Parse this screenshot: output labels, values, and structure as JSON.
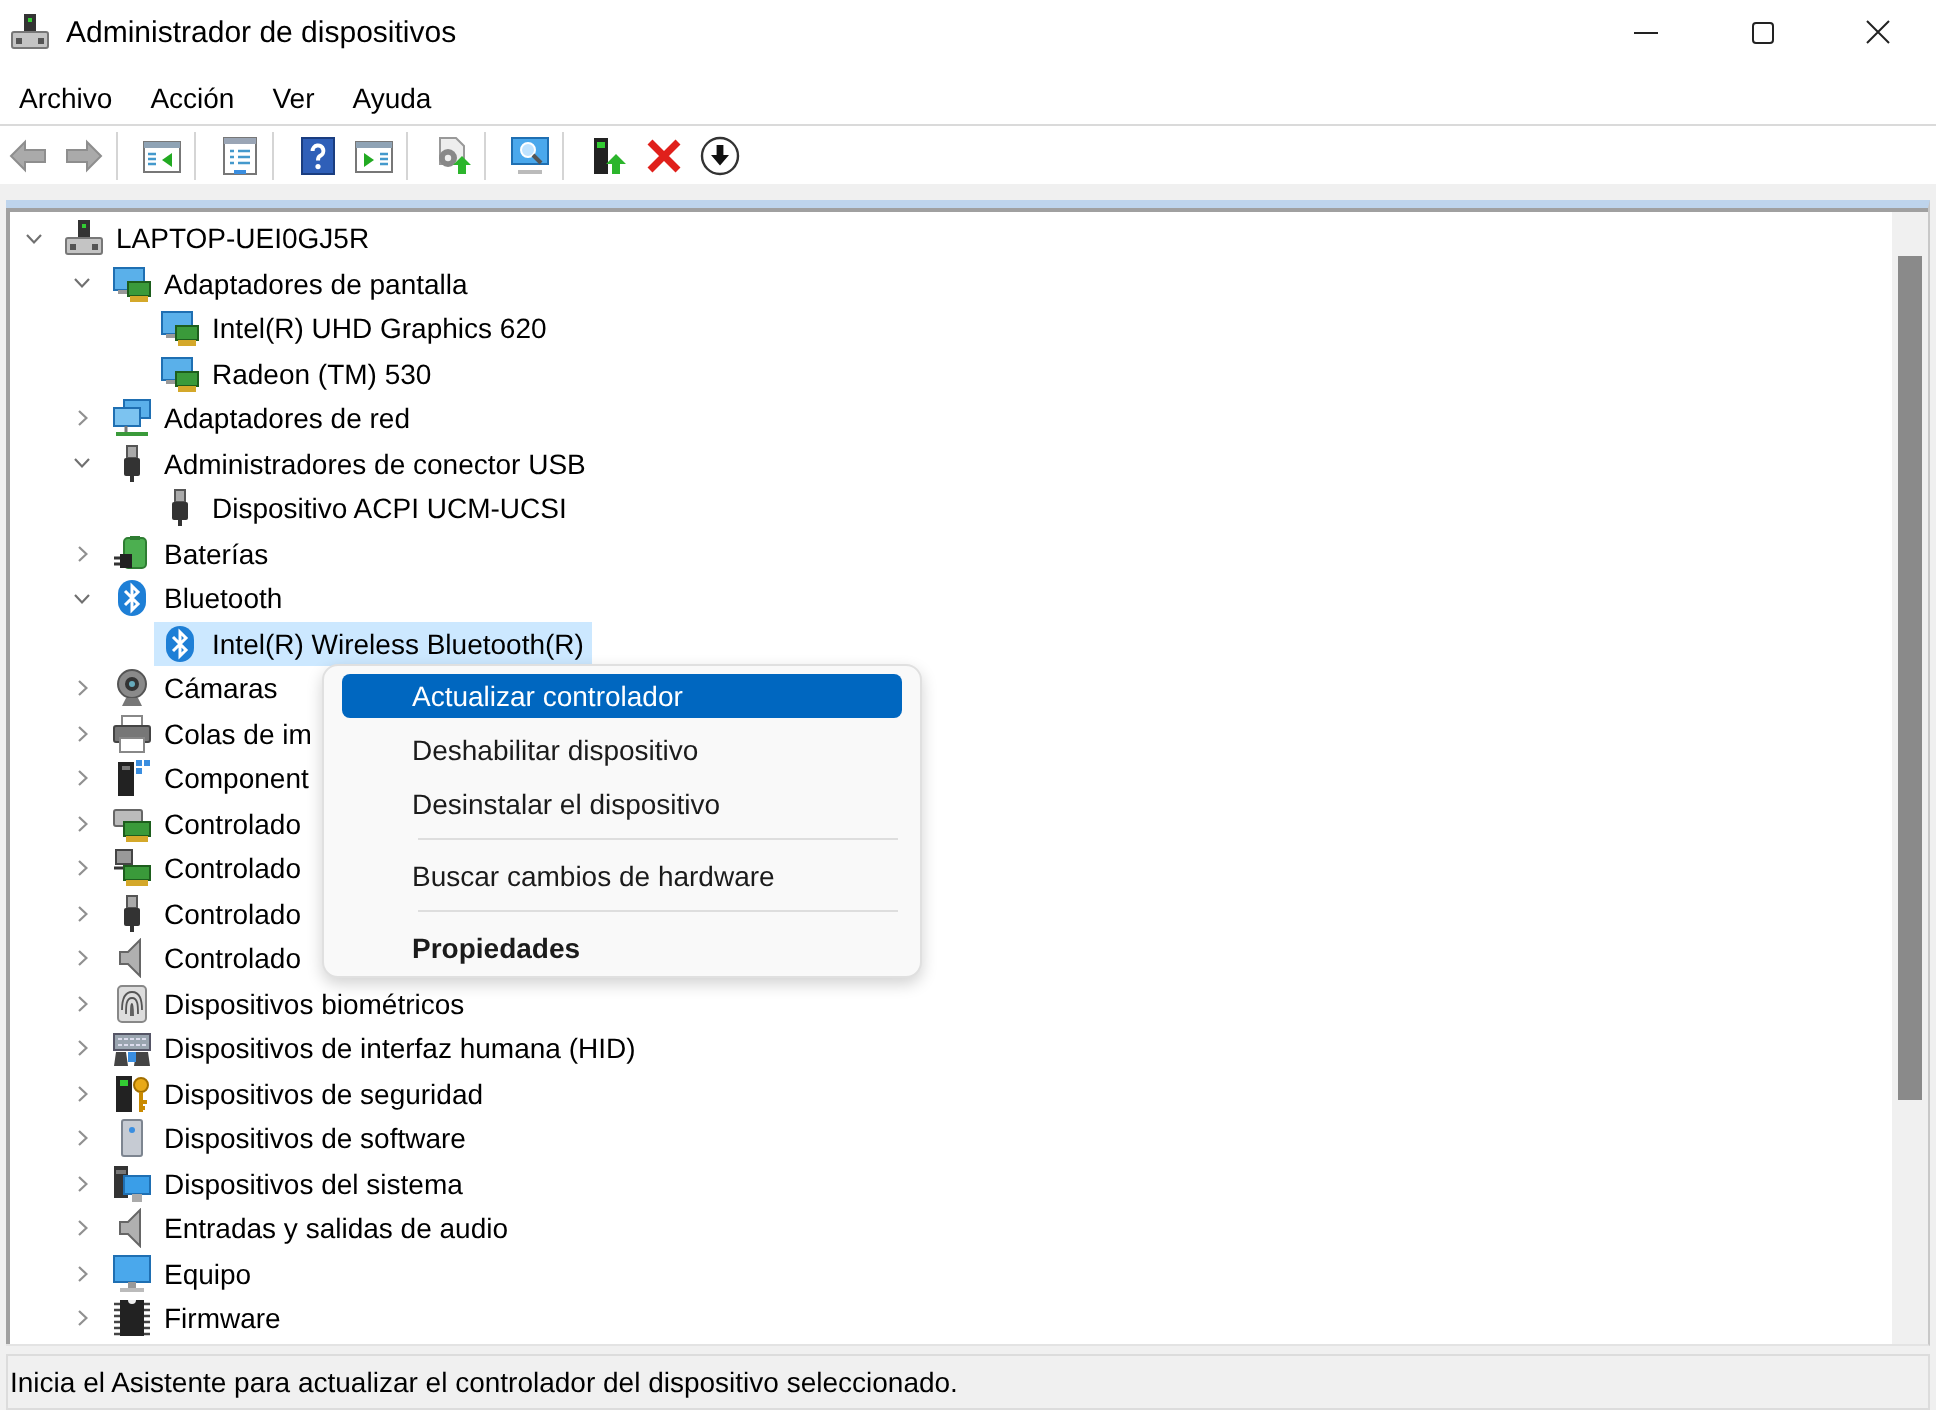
{
  "window": {
    "title": "Administrador de dispositivos"
  },
  "menu_bar": [
    "Archivo",
    "Acción",
    "Ver",
    "Ayuda"
  ],
  "toolbar": {
    "groups": [
      [
        {
          "kind": "back",
          "disabled": true
        },
        {
          "kind": "forward",
          "disabled": true
        }
      ],
      [
        {
          "kind": "console-tree",
          "disabled": false
        }
      ],
      [
        {
          "kind": "properties",
          "disabled": false
        }
      ],
      [
        {
          "kind": "help",
          "disabled": false
        },
        {
          "kind": "action-pane",
          "disabled": false
        }
      ],
      [
        {
          "kind": "scan",
          "disabled": false
        }
      ],
      [
        {
          "kind": "monitor-search",
          "disabled": false
        }
      ],
      [
        {
          "kind": "update",
          "disabled": false
        },
        {
          "kind": "uninstall",
          "disabled": false
        },
        {
          "kind": "disable",
          "disabled": false
        }
      ]
    ]
  },
  "tree": [
    {
      "label": "LAPTOP-UEI0GJ5R",
      "kind": "computer",
      "expanded": true,
      "selected": false,
      "children": [
        {
          "label": "Adaptadores de pantalla",
          "kind": "display",
          "expanded": true,
          "selected": false,
          "children": [
            {
              "label": "Intel(R) UHD Graphics 620",
              "kind": "display",
              "selected": false
            },
            {
              "label": "Radeon (TM) 530",
              "kind": "display",
              "selected": false
            }
          ]
        },
        {
          "label": "Adaptadores de red",
          "kind": "network",
          "expanded": false,
          "selected": false
        },
        {
          "label": "Administradores de conector USB",
          "kind": "usb",
          "expanded": true,
          "selected": false,
          "children": [
            {
              "label": "Dispositivo ACPI UCM-UCSI",
              "kind": "usb",
              "selected": false
            }
          ]
        },
        {
          "label": "Baterías",
          "kind": "battery",
          "expanded": false,
          "selected": false
        },
        {
          "label": "Bluetooth",
          "kind": "bluetooth",
          "expanded": true,
          "selected": false,
          "children": [
            {
              "label": "Intel(R) Wireless Bluetooth(R)",
              "kind": "bluetooth",
              "selected": true
            }
          ]
        },
        {
          "label": "Cámaras",
          "kind": "camera",
          "expanded": false,
          "selected": false
        },
        {
          "label": "Colas de im",
          "kind": "printer",
          "expanded": false,
          "selected": false
        },
        {
          "label": "Component",
          "kind": "component",
          "expanded": false,
          "selected": false
        },
        {
          "label": "Controlado",
          "kind": "disk-card",
          "expanded": false,
          "selected": false
        },
        {
          "label": "Controlado",
          "kind": "plug-card",
          "expanded": false,
          "selected": false
        },
        {
          "label": "Controlado",
          "kind": "usb",
          "expanded": false,
          "selected": false
        },
        {
          "label": "Controlado",
          "kind": "speaker",
          "expanded": false,
          "selected": false
        },
        {
          "label": "Dispositivos biométricos",
          "kind": "fingerprint",
          "expanded": false,
          "selected": false
        },
        {
          "label": "Dispositivos de interfaz humana (HID)",
          "kind": "hid",
          "expanded": false,
          "selected": false
        },
        {
          "label": "Dispositivos de seguridad",
          "kind": "security",
          "expanded": false,
          "selected": false
        },
        {
          "label": "Dispositivos de software",
          "kind": "software",
          "expanded": false,
          "selected": false
        },
        {
          "label": "Dispositivos del sistema",
          "kind": "system",
          "expanded": false,
          "selected": false
        },
        {
          "label": "Entradas y salidas de audio",
          "kind": "speaker",
          "expanded": false,
          "selected": false
        },
        {
          "label": "Equipo",
          "kind": "monitor",
          "expanded": false,
          "selected": false
        },
        {
          "label": "Firmware",
          "kind": "chip",
          "expanded": false,
          "selected": false
        }
      ]
    }
  ],
  "context_menu": {
    "items": [
      {
        "kind": "item",
        "label": "Actualizar controlador",
        "selected": true,
        "default": false
      },
      {
        "kind": "item",
        "label": "Deshabilitar dispositivo",
        "selected": false,
        "default": false
      },
      {
        "kind": "item",
        "label": "Desinstalar el dispositivo",
        "selected": false,
        "default": false
      },
      {
        "kind": "separator"
      },
      {
        "kind": "item",
        "label": "Buscar cambios de hardware",
        "selected": false,
        "default": false
      },
      {
        "kind": "separator"
      },
      {
        "kind": "item",
        "label": "Propiedades",
        "selected": false,
        "default": true
      }
    ]
  },
  "status_bar": {
    "text": "Inicia el Asistente para actualizar el controlador del dispositivo seleccionado."
  }
}
